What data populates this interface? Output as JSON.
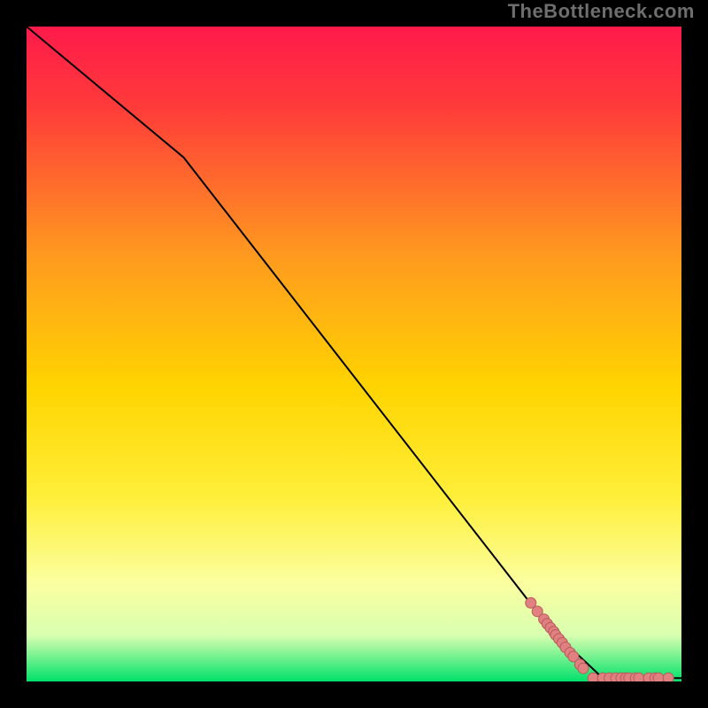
{
  "watermark": "TheBottleneck.com",
  "colors": {
    "frame_bg": "#000000",
    "grad_top": "#ff1a4b",
    "grad_mid1": "#ff7a2a",
    "grad_mid2": "#ffe100",
    "grad_pale": "#ffffbf",
    "grad_bottom": "#00e16a",
    "line": "#000000",
    "marker_fill": "#e08080",
    "marker_stroke": "#b85a5a"
  },
  "chart_data": {
    "type": "line",
    "title": "",
    "xlabel": "",
    "ylabel": "",
    "xlim": [
      0,
      100
    ],
    "ylim": [
      0,
      100
    ],
    "series": [
      {
        "name": "curve",
        "style": "line",
        "x": [
          0,
          24,
          80,
          88,
          100
        ],
        "y": [
          100,
          80,
          8,
          0.5,
          0.5
        ]
      },
      {
        "name": "markers",
        "style": "points",
        "x": [
          77,
          78,
          79,
          79.5,
          80,
          80.5,
          80.8,
          81.3,
          81.8,
          82.3,
          83,
          83.5,
          84.5,
          85,
          86.5,
          88,
          89,
          90,
          90.8,
          91.5,
          92,
          93,
          93.5,
          95,
          96,
          96.5,
          98
        ],
        "y": [
          12,
          10.7,
          9.5,
          8.8,
          8.2,
          7.6,
          7.1,
          6.5,
          5.9,
          5.2,
          4.4,
          3.8,
          2.6,
          2.0,
          0.5,
          0.5,
          0.5,
          0.5,
          0.5,
          0.5,
          0.5,
          0.5,
          0.5,
          0.5,
          0.5,
          0.5,
          0.5
        ]
      }
    ],
    "gradient_stops": [
      {
        "offset": 0.0,
        "color": "#ff1a4b"
      },
      {
        "offset": 0.12,
        "color": "#ff3a3a"
      },
      {
        "offset": 0.35,
        "color": "#ff9a1f"
      },
      {
        "offset": 0.55,
        "color": "#ffd400"
      },
      {
        "offset": 0.72,
        "color": "#ffef3a"
      },
      {
        "offset": 0.85,
        "color": "#fbffa0"
      },
      {
        "offset": 0.93,
        "color": "#d8ffb0"
      },
      {
        "offset": 1.0,
        "color": "#00e16a"
      }
    ]
  }
}
